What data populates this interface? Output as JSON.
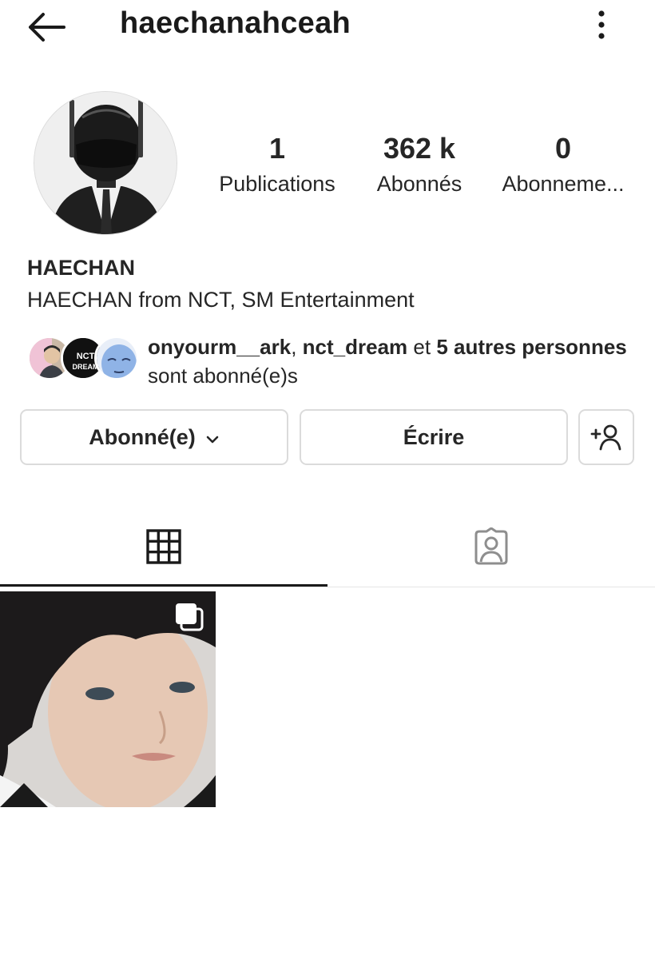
{
  "header": {
    "username": "haechanahceah",
    "back_icon": "arrow-left-icon",
    "more_icon": "more-vertical-icon"
  },
  "stats": {
    "posts": {
      "count": "1",
      "label": "Publications"
    },
    "followers": {
      "count": "362 k",
      "label": "Abonnés"
    },
    "following": {
      "count": "0",
      "label": "Abonneme..."
    }
  },
  "profile": {
    "full_name": "HAECHAN",
    "bio": "HAECHAN from NCT, SM Entertainment"
  },
  "mutual": {
    "user1": "onyourm__ark",
    "separator": ",",
    "user2": "nct_dream",
    "connector": "et",
    "others": "5 autres personnes",
    "suffix": "sont abonné(e)s",
    "avatar2_text": "NCT DREAM"
  },
  "actions": {
    "follow_label": "Abonné(e)",
    "message_label": "Écrire",
    "add_user_icon": "add-user-icon"
  },
  "tabs": [
    {
      "name": "grid",
      "icon": "grid-icon",
      "active": true
    },
    {
      "name": "tagged",
      "icon": "tagged-person-icon",
      "active": false
    }
  ],
  "posts": [
    {
      "type": "carousel",
      "icon": "multiple-posts-icon"
    }
  ],
  "colors": {
    "text": "#262626",
    "border": "#dbdbdb",
    "background": "#ffffff",
    "icon_muted": "#8e8e8e"
  }
}
